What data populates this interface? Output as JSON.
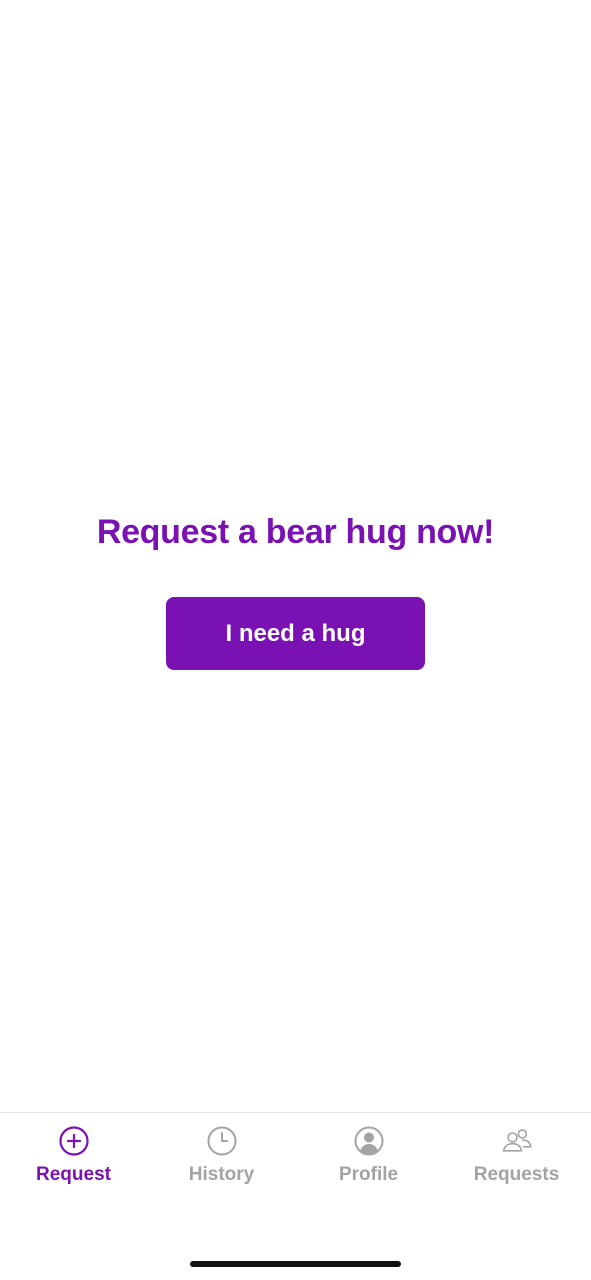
{
  "colors": {
    "accent": "#7a12b3",
    "inactive": "#a3a3a3",
    "background": "#ffffff",
    "button_text": "#ffffff"
  },
  "main": {
    "headline": "Request a bear hug now!",
    "hug_button_label": "I need a hug"
  },
  "tab_bar": {
    "tabs": [
      {
        "label": "Request",
        "icon": "plus-circle-icon",
        "active": true
      },
      {
        "label": "History",
        "icon": "clock-icon",
        "active": false
      },
      {
        "label": "Profile",
        "icon": "user-circle-icon",
        "active": false
      },
      {
        "label": "Requests",
        "icon": "users-icon",
        "active": false
      }
    ]
  }
}
